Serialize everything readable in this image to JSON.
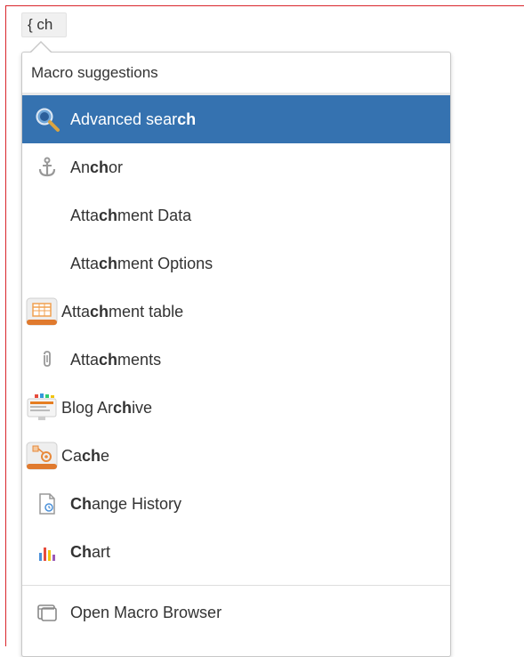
{
  "editor": {
    "trigger_text": "{ ch"
  },
  "dropdown": {
    "header": "Macro suggestions",
    "items": [
      {
        "pre": "Advanced sear",
        "match": "ch",
        "post": "",
        "icon": "magnifier-icon",
        "selected": true
      },
      {
        "pre": "An",
        "match": "ch",
        "post": "or",
        "icon": "anchor-icon"
      },
      {
        "pre": "Atta",
        "match": "ch",
        "post": "ment Data",
        "icon": ""
      },
      {
        "pre": "Atta",
        "match": "ch",
        "post": "ment Options",
        "icon": ""
      },
      {
        "pre": "Atta",
        "match": "ch",
        "post": "ment table",
        "icon": "attachment-table-icon"
      },
      {
        "pre": "Atta",
        "match": "ch",
        "post": "ments",
        "icon": "paperclip-icon"
      },
      {
        "pre": "Blog Ar",
        "match": "ch",
        "post": "ive",
        "icon": "blog-archive-icon"
      },
      {
        "pre": "Ca",
        "match": "ch",
        "post": "e",
        "icon": "cache-icon"
      },
      {
        "pre": "",
        "match": "Ch",
        "post": "ange History",
        "icon": "document-history-icon"
      },
      {
        "pre": "",
        "match": "Ch",
        "post": "art",
        "icon": "chart-icon"
      }
    ],
    "footer": {
      "label": "Open Macro Browser",
      "icon": "macro-browser-icon"
    }
  },
  "colors": {
    "selected_bg": "#3572b0",
    "frame_border": "#d9262b"
  }
}
